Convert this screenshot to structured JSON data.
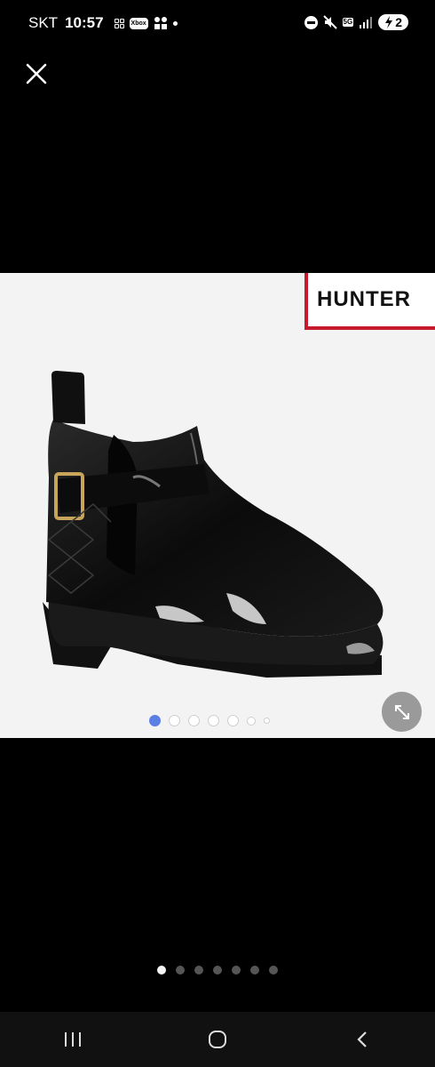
{
  "status_bar": {
    "carrier": "SKT",
    "time": "10:57",
    "xbox_badge": "Xbox",
    "network": "5G",
    "battery_label": "2"
  },
  "gallery": {
    "brand_logo_text": "HUNTER",
    "inner_pager": {
      "count": 7,
      "active_index": 0
    },
    "outer_pager": {
      "count": 7,
      "active_index": 0
    }
  },
  "colors": {
    "brand_red": "#c61b2c",
    "active_dot": "#5c7fe6",
    "image_background": "#f3f3f3"
  },
  "icons": {
    "close": "close-icon",
    "expand": "expand-icon",
    "nav_recent": "recent-apps-icon",
    "nav_home": "home-icon",
    "nav_back": "back-icon"
  }
}
